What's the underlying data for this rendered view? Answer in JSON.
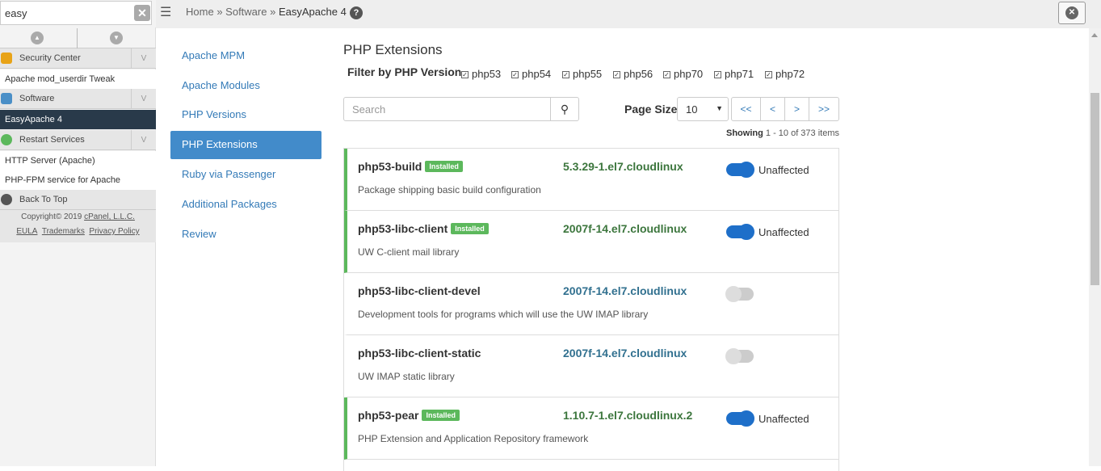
{
  "sidebar": {
    "search_value": "easy",
    "categories": [
      {
        "label": "Security Center"
      },
      {
        "label": "Software"
      },
      {
        "label": "Restart Services"
      }
    ],
    "items": {
      "userdir": "Apache mod_userdir Tweak",
      "easyapache": "EasyApache 4",
      "http_server": "HTTP Server (Apache)",
      "php_fpm": "PHP-FPM service for Apache"
    },
    "back_to_top": "Back To Top",
    "copyright": "Copyright© 2019",
    "copyright_link": "cPanel, L.L.C.",
    "links": [
      "EULA",
      "Trademarks",
      "Privacy Policy"
    ]
  },
  "breadcrumb": {
    "home": "Home",
    "sep": "»",
    "software": "Software",
    "current": "EasyApache 4"
  },
  "nav": [
    {
      "label": "Apache MPM"
    },
    {
      "label": "Apache Modules"
    },
    {
      "label": "PHP Versions"
    },
    {
      "label": "PHP Extensions"
    },
    {
      "label": "Ruby via Passenger"
    },
    {
      "label": "Additional Packages"
    },
    {
      "label": "Review"
    }
  ],
  "main": {
    "title": "PHP Extensions",
    "filter_label": "Filter by PHP Version",
    "filters": [
      "php53",
      "php54",
      "php55",
      "php56",
      "php70",
      "php71",
      "php72"
    ],
    "search_placeholder": "Search",
    "page_size_label": "Page Size",
    "page_size_value": "10",
    "pager": [
      "<<",
      "<",
      ">",
      ">>"
    ],
    "showing_label": "Showing",
    "showing_range": "1 - 10 of 373 items"
  },
  "packages": [
    {
      "name": "php53-build",
      "installed": true,
      "badge": "Installed",
      "version": "5.3.29-1.el7.cloudlinux",
      "desc": "Package shipping basic build configuration",
      "on": true,
      "status": "Unaffected"
    },
    {
      "name": "php53-libc-client",
      "installed": true,
      "badge": "Installed",
      "version": "2007f-14.el7.cloudlinux",
      "desc": "UW C-client mail library",
      "on": true,
      "status": "Unaffected"
    },
    {
      "name": "php53-libc-client-devel",
      "installed": false,
      "badge": "",
      "version": "2007f-14.el7.cloudlinux",
      "desc": "Development tools for programs which will use the UW IMAP library",
      "on": false,
      "status": ""
    },
    {
      "name": "php53-libc-client-static",
      "installed": false,
      "badge": "",
      "version": "2007f-14.el7.cloudlinux",
      "desc": "UW IMAP static library",
      "on": false,
      "status": ""
    },
    {
      "name": "php53-pear",
      "installed": true,
      "badge": "Installed",
      "version": "1.10.7-1.el7.cloudlinux.2",
      "desc": "PHP Extension and Application Repository framework",
      "on": true,
      "status": "Unaffected"
    }
  ],
  "colors": {
    "installed_green": "#5cb85c",
    "link_blue": "#337ab7",
    "active_nav": "#428bca",
    "toggle_on": "#1e6fc9",
    "sidebar_active": "#293a4a"
  }
}
